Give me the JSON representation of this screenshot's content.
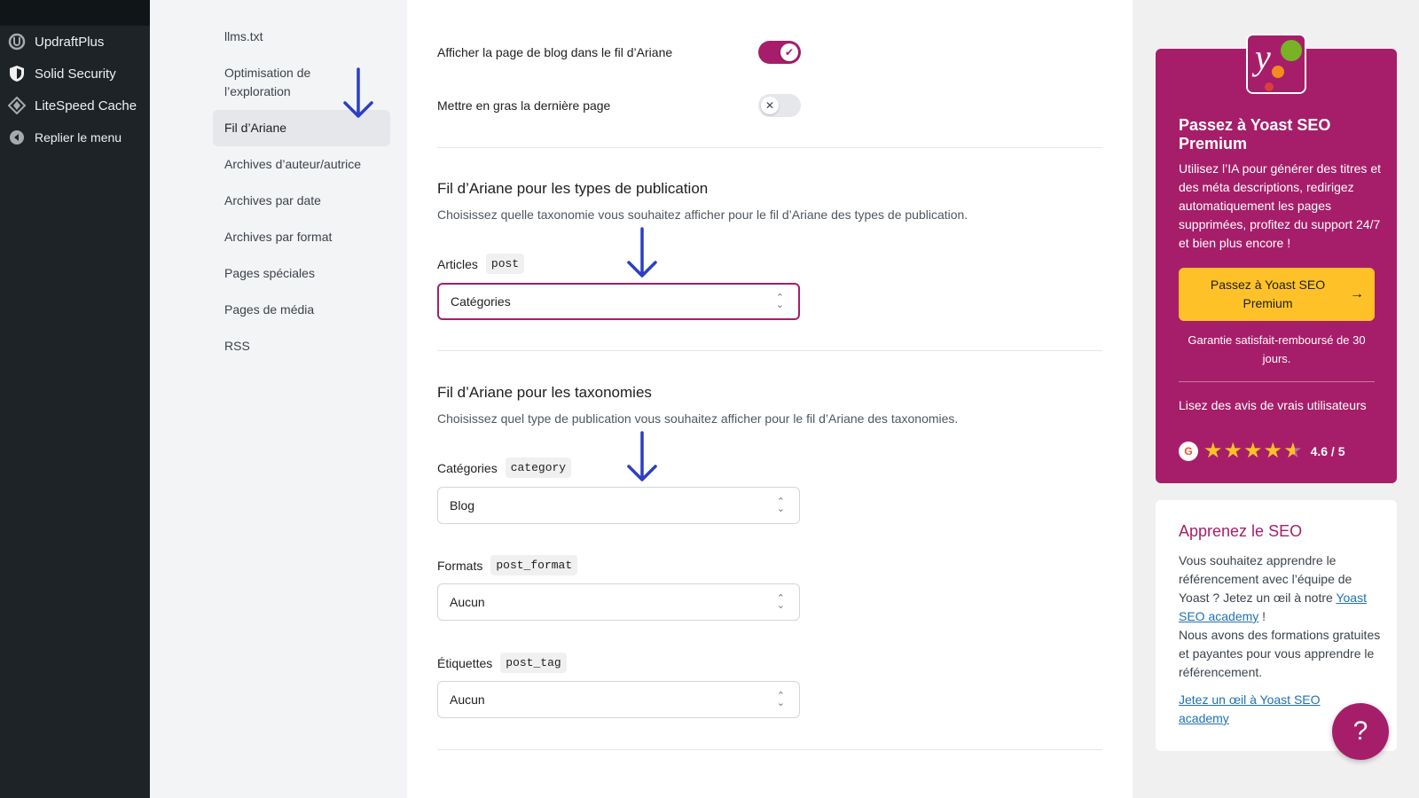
{
  "wp_menu": [
    {
      "label": "UpdraftPlus",
      "icon": "updraft-icon"
    },
    {
      "label": "Solid Security",
      "icon": "shield-icon"
    },
    {
      "label": "LiteSpeed Cache",
      "icon": "diamond-icon"
    }
  ],
  "wp_collapse": "Replier le menu",
  "subnav": [
    {
      "label": "llms.txt"
    },
    {
      "label": "Optimisation de l’exploration"
    },
    {
      "label": "Fil d’Ariane",
      "active": true
    },
    {
      "label": "Archives d’auteur/autrice"
    },
    {
      "label": "Archives par date"
    },
    {
      "label": "Archives par format"
    },
    {
      "label": "Pages spéciales"
    },
    {
      "label": "Pages de média"
    },
    {
      "label": "RSS"
    }
  ],
  "toggles": {
    "blog_page": {
      "label": "Afficher la page de blog dans le fil d’Ariane",
      "on": true
    },
    "bold_last": {
      "label": "Mettre en gras la dernière page",
      "on": false
    }
  },
  "post_types_section": {
    "title": "Fil d’Ariane pour les types de publication",
    "desc": "Choisissez quelle taxonomie vous souhaitez afficher pour le fil d’Ariane des types de publication.",
    "fields": [
      {
        "label": "Articles",
        "code": "post",
        "value": "Catégories"
      }
    ]
  },
  "taxonomies_section": {
    "title": "Fil d’Ariane pour les taxonomies",
    "desc": "Choisissez quel type de publication vous souhaitez afficher pour le fil d’Ariane des taxonomies.",
    "fields": [
      {
        "label": "Catégories",
        "code": "category",
        "value": "Blog"
      },
      {
        "label": "Formats",
        "code": "post_format",
        "value": "Aucun"
      },
      {
        "label": "Étiquettes",
        "code": "post_tag",
        "value": "Aucun"
      }
    ]
  },
  "promo": {
    "title": "Passez à Yoast SEO Premium",
    "text": "Utilisez l’IA pour générer des titres et des méta descriptions, redirigez automatiquement les pages supprimées, profitez du support 24/7 et bien plus encore !",
    "button": "Passez à Yoast SEO Premium",
    "button_arrow": "→",
    "guarantee": "Garantie satisfait-remboursé de 30 jours.",
    "reviews": "Lisez des avis de vrais utilisateurs",
    "rating": "4.6 / 5",
    "rating_stars": 4.6,
    "g2_label": "G"
  },
  "learn": {
    "title": "Apprenez le SEO",
    "text_before": "Vous souhaitez apprendre le référencement avec l’équipe de Yoast ? Jetez un œil à notre ",
    "text_link": "Yoast SEO academy",
    "text_after": " !",
    "text_2": "Nous avons des formations gratuites et payantes pour vous apprendre le référencement.",
    "link": "Jetez un œil à Yoast SEO academy"
  },
  "help_button": "?",
  "colors": {
    "brand": "#a61e69",
    "button_yellow": "#fec228",
    "annotation_arrow": "#2b3fc4"
  }
}
